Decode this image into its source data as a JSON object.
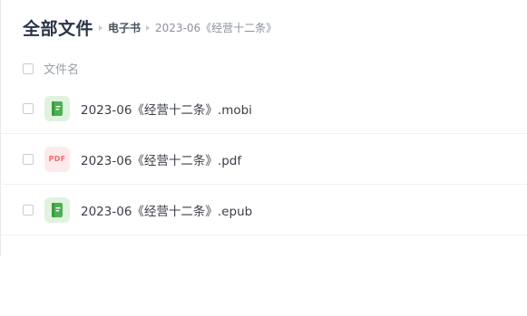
{
  "breadcrumb": {
    "root": "全部文件",
    "folder": "电子书",
    "current": "2023-06《经营十二条》"
  },
  "list_header": {
    "name_column": "文件名"
  },
  "files": [
    {
      "name": "2023-06《经营十二条》.mobi",
      "icon": "ebook-icon"
    },
    {
      "name": "2023-06《经营十二条》.pdf",
      "icon": "pdf-icon",
      "icon_text": "PDF"
    },
    {
      "name": "2023-06《经营十二条》.epub",
      "icon": "ebook-icon"
    }
  ],
  "colors": {
    "ebook_icon_bg": "#dff3df",
    "ebook_icon_fg": "#4cb050",
    "pdf_icon_bg": "#fdebec",
    "pdf_icon_fg": "#f06a6f"
  }
}
